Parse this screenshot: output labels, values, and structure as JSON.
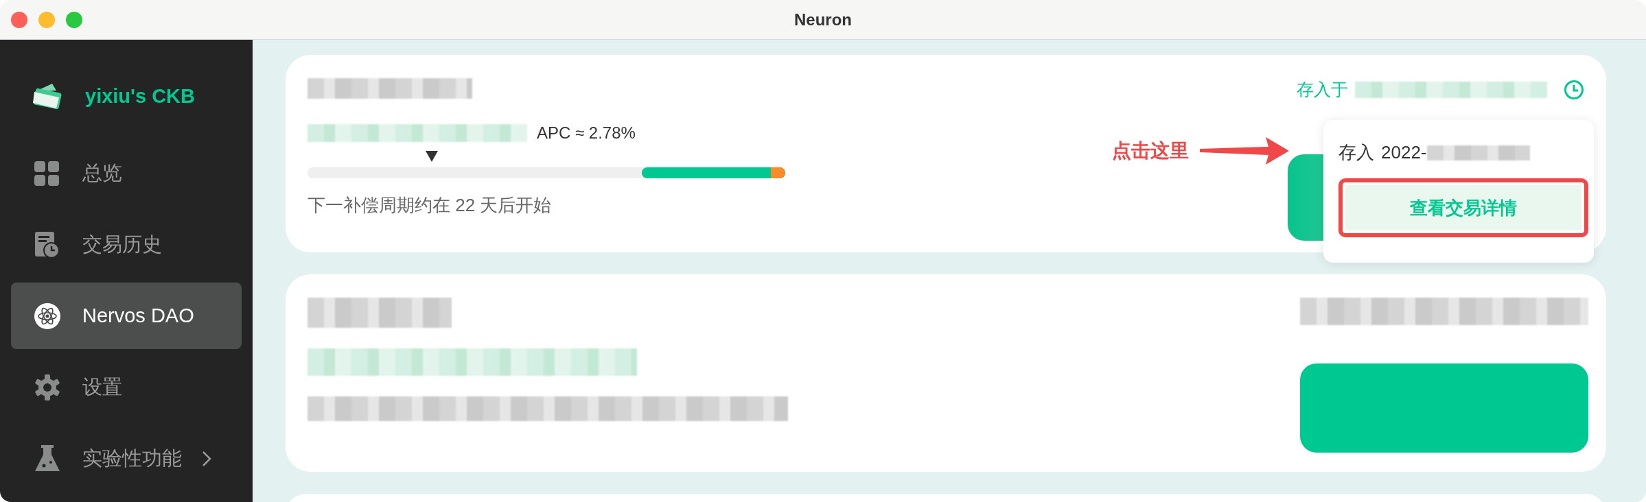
{
  "window": {
    "title": "Neuron"
  },
  "sidebar": {
    "wallet_name": "yixiu's CKB",
    "items": [
      {
        "label": "总览",
        "selected": false,
        "submenu": false
      },
      {
        "label": "交易历史",
        "selected": false,
        "submenu": false
      },
      {
        "label": "Nervos DAO",
        "selected": true,
        "submenu": false
      },
      {
        "label": "设置",
        "selected": false,
        "submenu": false
      },
      {
        "label": "实验性功能",
        "selected": false,
        "submenu": true
      }
    ]
  },
  "cards": [
    {
      "kind": "clear",
      "amount": {
        "kind": "blurred"
      },
      "reward": {
        "kind": "blurred"
      },
      "apc": "APC ≈ 2.78%",
      "note": "下一补偿周期约在 22 天后开始",
      "deposit_label": "存入于",
      "deposit_time": {
        "kind": "blurred"
      },
      "popover": {
        "label": "存入",
        "date": "2022-",
        "button": "查看交易详情",
        "highlighted": true
      }
    },
    {
      "kind": "blurred"
    }
  ],
  "annotation": {
    "text": "点击这里"
  }
}
